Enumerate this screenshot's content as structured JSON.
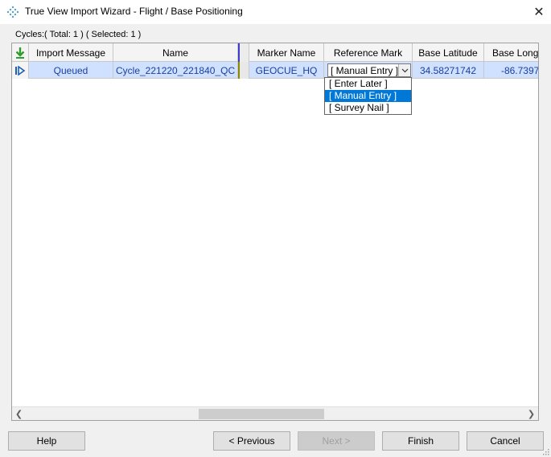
{
  "window": {
    "title": "True View Import Wizard - Flight / Base Positioning",
    "icon": "app-diamond-icon",
    "close_glyph": "✕"
  },
  "cycles_label": "Cycles:( Total: 1 ) ( Selected: 1 )",
  "grid": {
    "columns": [
      "Import Message",
      "Name",
      "Marker Name",
      "Reference Mark",
      "Base Latitude",
      "Base Long"
    ],
    "row": {
      "import_message": "Queued",
      "name": "Cycle_221220_221840_QC",
      "marker_name": "GEOCUE_HQ",
      "reference_mark": "[ Manual Entry ]",
      "base_latitude": "34.58271742",
      "base_longitude": "-86.73970"
    },
    "reference_options": [
      "[ Enter Later ]",
      "[ Manual Entry ]",
      "[ Survey Nail ]"
    ],
    "selected_option": "[ Manual Entry ]"
  },
  "buttons": {
    "help": "Help",
    "previous": "< Previous",
    "next": "Next >",
    "finish": "Finish",
    "cancel": "Cancel"
  },
  "colors": {
    "selected_row": "#cfe1ff",
    "row_text": "#1a3fa0",
    "highlight": "#0078d7"
  }
}
